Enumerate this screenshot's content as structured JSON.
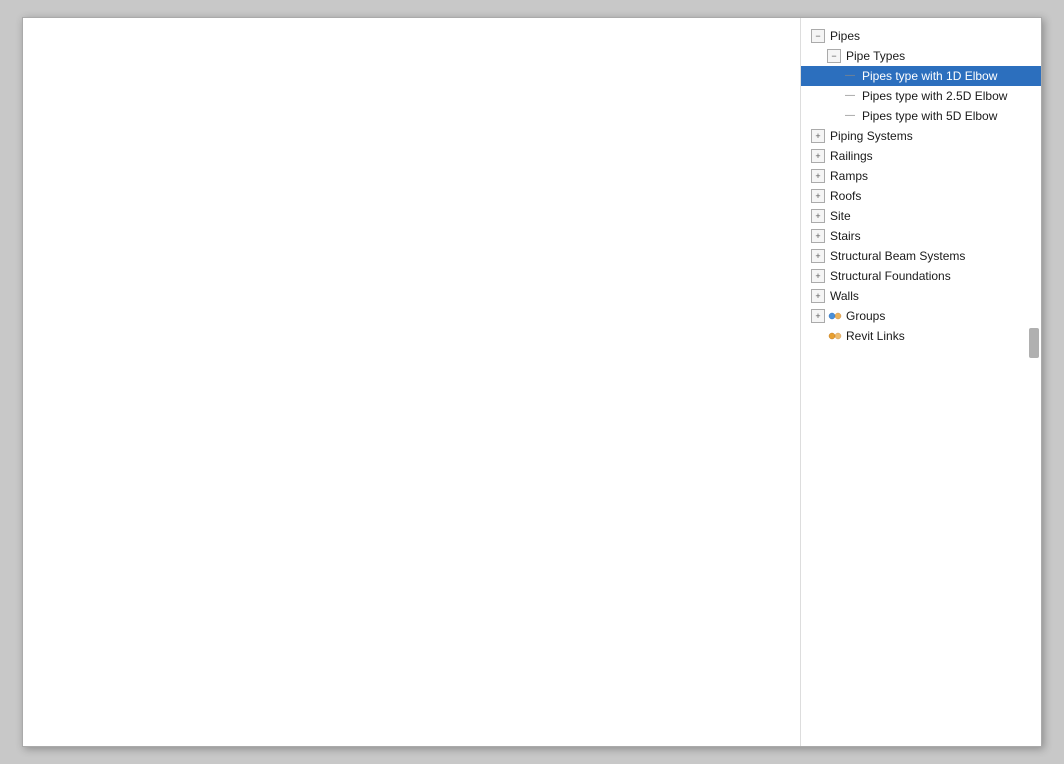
{
  "tree": {
    "nodes": [
      {
        "id": "pipes",
        "label": "Pipes",
        "level": 0,
        "expander": "minus",
        "icon": "none",
        "selected": false
      },
      {
        "id": "pipe-types",
        "label": "Pipe Types",
        "level": 1,
        "expander": "minus",
        "icon": "none",
        "selected": false
      },
      {
        "id": "pipe-1d",
        "label": "Pipes type with 1D Elbow",
        "level": 2,
        "expander": "leaf",
        "icon": "none",
        "selected": true
      },
      {
        "id": "pipe-2d5",
        "label": "Pipes type with 2.5D Elbow",
        "level": 2,
        "expander": "leaf",
        "icon": "none",
        "selected": false
      },
      {
        "id": "pipe-5d",
        "label": "Pipes type with 5D Elbow",
        "level": 2,
        "expander": "leaf",
        "icon": "none",
        "selected": false
      },
      {
        "id": "piping-systems",
        "label": "Piping Systems",
        "level": 0,
        "expander": "plus",
        "icon": "none",
        "selected": false
      },
      {
        "id": "railings",
        "label": "Railings",
        "level": 0,
        "expander": "plus",
        "icon": "none",
        "selected": false
      },
      {
        "id": "ramps",
        "label": "Ramps",
        "level": 0,
        "expander": "plus",
        "icon": "none",
        "selected": false
      },
      {
        "id": "roofs",
        "label": "Roofs",
        "level": 0,
        "expander": "plus",
        "icon": "none",
        "selected": false
      },
      {
        "id": "site",
        "label": "Site",
        "level": 0,
        "expander": "plus",
        "icon": "none",
        "selected": false
      },
      {
        "id": "stairs",
        "label": "Stairs",
        "level": 0,
        "expander": "plus",
        "icon": "none",
        "selected": false
      },
      {
        "id": "structural-beam-systems",
        "label": "Structural Beam Systems",
        "level": 0,
        "expander": "plus",
        "icon": "none",
        "selected": false
      },
      {
        "id": "structural-foundations",
        "label": "Structural Foundations",
        "level": 0,
        "expander": "plus",
        "icon": "none",
        "selected": false
      },
      {
        "id": "walls",
        "label": "Walls",
        "level": 0,
        "expander": "plus",
        "icon": "none",
        "selected": false
      },
      {
        "id": "groups",
        "label": "Groups",
        "level": 0,
        "expander": "plus",
        "icon": "group",
        "selected": false
      },
      {
        "id": "revit-links",
        "label": "Revit Links",
        "level": 0,
        "expander": "none",
        "icon": "link",
        "selected": false
      }
    ]
  }
}
